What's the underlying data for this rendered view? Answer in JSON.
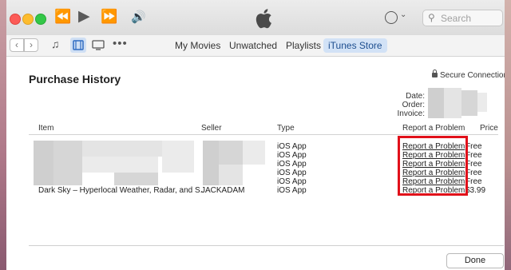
{
  "toolbar": {
    "search_placeholder": "Search",
    "media_icons": [
      "music-icon",
      "movies-icon",
      "tv-icon",
      "more-icon"
    ]
  },
  "nav": {
    "tabs": [
      {
        "label": "My Movies",
        "active": false
      },
      {
        "label": "Unwatched",
        "active": false
      },
      {
        "label": "Playlists",
        "active": false
      },
      {
        "label": "iTunes Store",
        "active": true
      }
    ]
  },
  "page": {
    "title": "Purchase History",
    "secure_label": "Secure Connection",
    "date_label": "Date:",
    "order_label": "Order:",
    "invoice_label": "Invoice:"
  },
  "table": {
    "columns": {
      "item": "Item",
      "seller": "Seller",
      "type": "Type",
      "report": "Report a Problem",
      "price": "Price"
    },
    "rows": [
      {
        "item": "",
        "seller": "",
        "type": "iOS App",
        "report": "Report a Problem",
        "price": "Free"
      },
      {
        "item": "",
        "seller": "",
        "type": "iOS App",
        "report": "Report a Problem",
        "price": "Free"
      },
      {
        "item": "",
        "seller": "",
        "type": "iOS App",
        "report": "Report a Problem",
        "price": "Free"
      },
      {
        "item": "",
        "seller": "",
        "type": "iOS App",
        "report": "Report a Problem",
        "price": "Free"
      },
      {
        "item": "",
        "seller": "",
        "type": "iOS App",
        "report": "Report a Problem",
        "price": "Free"
      },
      {
        "item": "Dark Sky – Hyperlocal Weather, Radar, and S...",
        "seller": "JACKADAM",
        "type": "iOS App",
        "report": "Report a Problem",
        "price": "$3.99"
      }
    ]
  },
  "footer": {
    "done_label": "Done"
  },
  "colors": {
    "highlight": "#e1101a",
    "active_tab": "#d2e2f6"
  }
}
